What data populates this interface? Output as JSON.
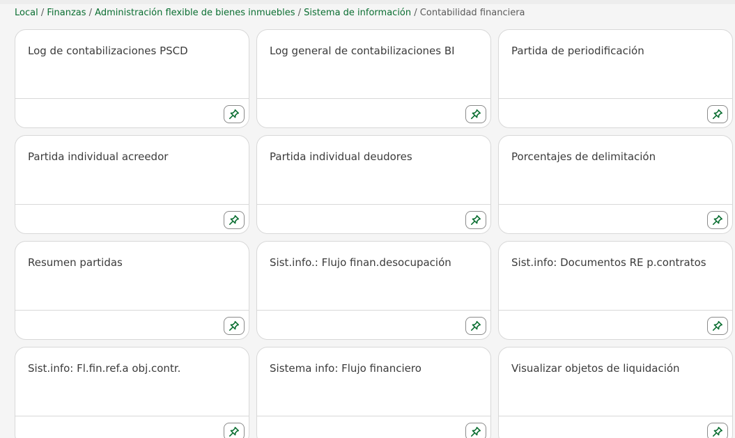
{
  "breadcrumb": {
    "items": [
      {
        "label": "Local",
        "link": true
      },
      {
        "label": "Finanzas",
        "link": true
      },
      {
        "label": "Administración flexible de bienes inmuebles",
        "link": true
      },
      {
        "label": "Sistema de información",
        "link": true
      },
      {
        "label": "Contabilidad financiera",
        "link": false
      }
    ],
    "separator": "/"
  },
  "tiles": [
    {
      "title": "Log de contabilizaciones PSCD",
      "icon": "pin-icon"
    },
    {
      "title": "Log general de contabilizaciones BI",
      "icon": "pin-icon"
    },
    {
      "title": "Partida de periodificación",
      "icon": "pin-icon"
    },
    {
      "title": "Partida individual acreedor",
      "icon": "pin-icon"
    },
    {
      "title": "Partida individual deudores",
      "icon": "pin-icon"
    },
    {
      "title": "Porcentajes de delimitación",
      "icon": "pin-icon"
    },
    {
      "title": "Resumen partidas",
      "icon": "pin-icon"
    },
    {
      "title": "Sist.info.: Flujo finan.desocupación",
      "icon": "pin-icon"
    },
    {
      "title": "Sist.info: Documentos RE p.contratos",
      "icon": "pin-icon"
    },
    {
      "title": "Sist.info: Fl.fin.ref.a obj.contr.",
      "icon": "pin-icon"
    },
    {
      "title": "Sistema info: Flujo financiero",
      "icon": "pin-icon"
    },
    {
      "title": "Visualizar objetos de liquidación",
      "icon": "pin-icon"
    }
  ],
  "colors": {
    "link": "#0a6e31",
    "text": "#3b3b3b",
    "pin": "#0a6e31",
    "background": "#f5f5f5"
  }
}
